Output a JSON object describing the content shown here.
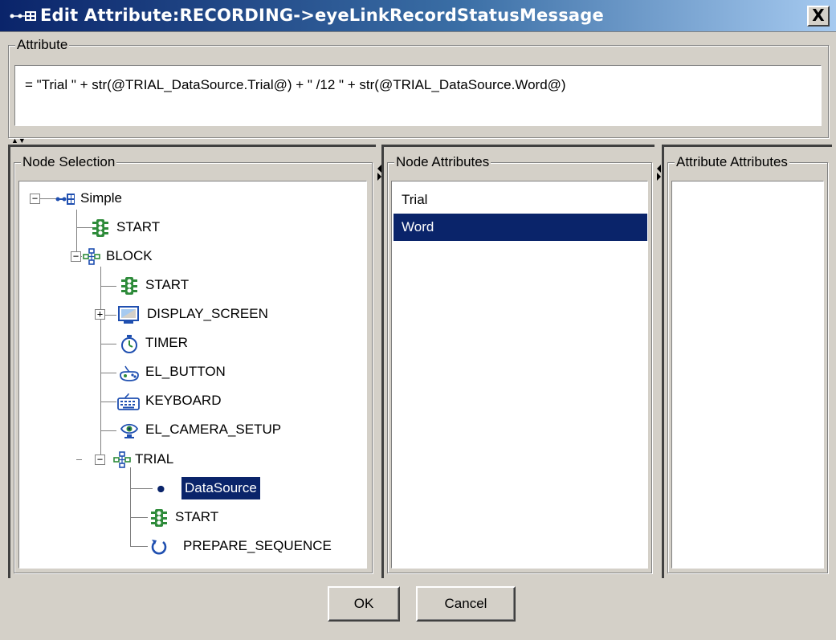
{
  "window": {
    "title": "Edit Attribute:RECORDING->eyeLinkRecordStatusMessage",
    "close_label": "X"
  },
  "attribute": {
    "legend": "Attribute",
    "expression": "= \"Trial \" + str(@TRIAL_DataSource.Trial@) + \" /12  \" + str(@TRIAL_DataSource.Word@)"
  },
  "node_selection": {
    "legend": "Node Selection",
    "nodes": [
      {
        "label": "Simple",
        "icon": "sequence-icon"
      },
      {
        "label": "START",
        "icon": "start-traffic-light-icon"
      },
      {
        "label": "BLOCK",
        "icon": "sequence-block-icon"
      },
      {
        "label": "START",
        "icon": "start-traffic-light-icon"
      },
      {
        "label": "DISPLAY_SCREEN",
        "icon": "display-screen-icon"
      },
      {
        "label": "TIMER",
        "icon": "timer-icon"
      },
      {
        "label": "EL_BUTTON",
        "icon": "gamepad-icon"
      },
      {
        "label": "KEYBOARD",
        "icon": "keyboard-icon"
      },
      {
        "label": "EL_CAMERA_SETUP",
        "icon": "eye-camera-icon"
      },
      {
        "label": "TRIAL",
        "icon": "sequence-block-icon"
      },
      {
        "label": "DataSource",
        "icon": "datasource-dot-icon"
      },
      {
        "label": "START",
        "icon": "start-traffic-light-icon"
      },
      {
        "label": "PREPARE_SEQUENCE",
        "icon": "prepare-sequence-icon"
      }
    ],
    "selected": "DataSource"
  },
  "node_attributes": {
    "legend": "Node Attributes",
    "items": [
      "Trial",
      "Word"
    ],
    "selected": "Word"
  },
  "attribute_attributes": {
    "legend": "Attribute Attributes",
    "items": []
  },
  "buttons": {
    "ok": "OK",
    "cancel": "Cancel"
  },
  "colors": {
    "selection": "#0a246a",
    "icon_green": "#2e8b3a",
    "icon_blue": "#1f4fb0"
  }
}
